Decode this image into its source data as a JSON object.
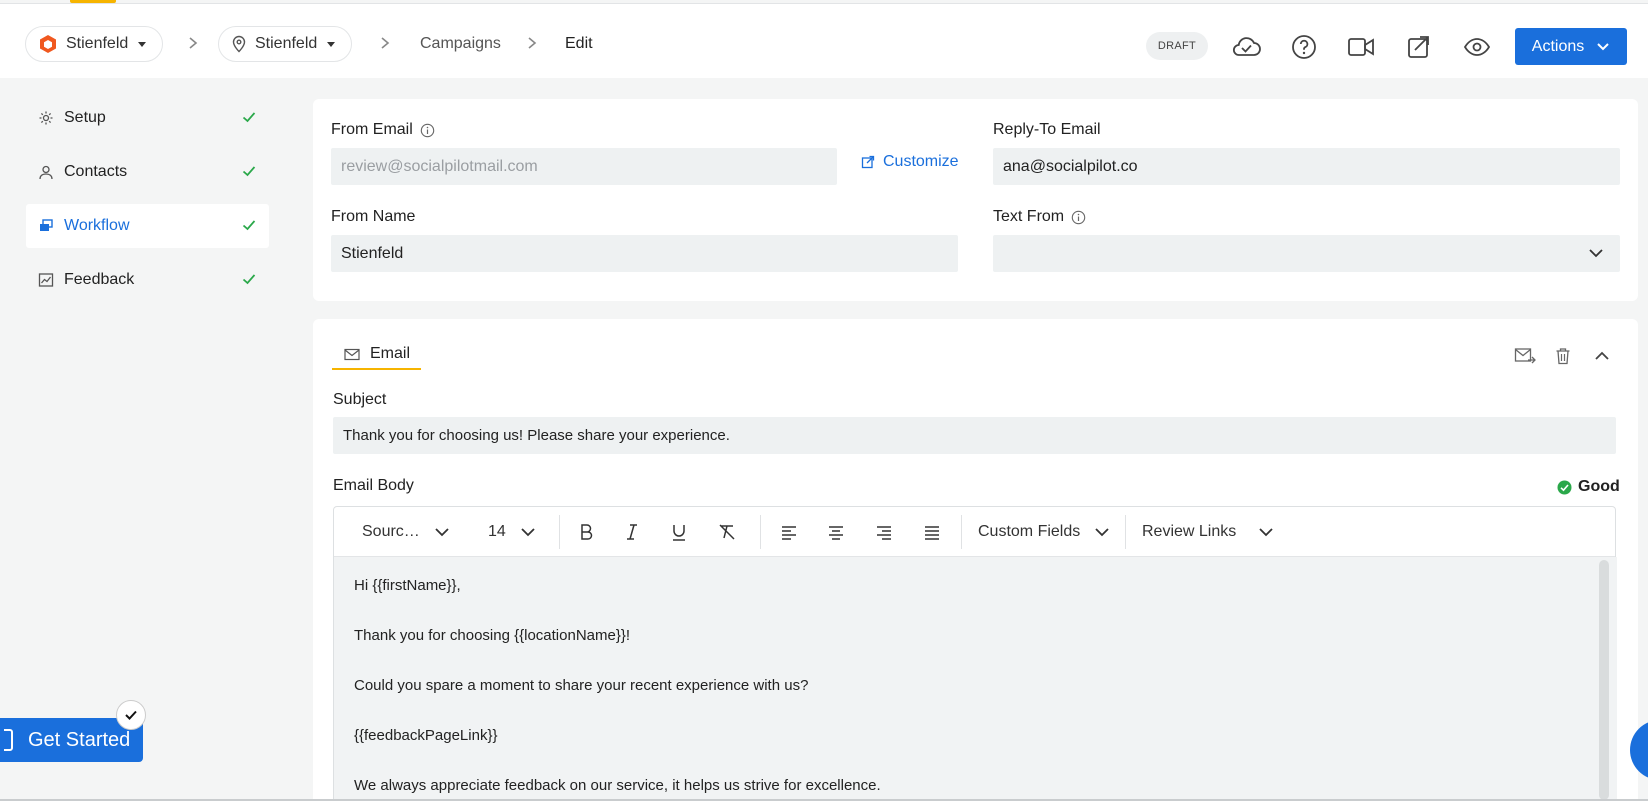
{
  "header": {
    "org_name": "Stienfeld",
    "location_name": "Stienfeld",
    "breadcrumbs": [
      "Campaigns",
      "Edit"
    ],
    "status": "DRAFT",
    "icons": [
      "cloud-check-icon",
      "help-icon",
      "video-icon",
      "send-icon",
      "eye-icon"
    ],
    "actions_label": "Actions"
  },
  "sidebar": {
    "items": [
      {
        "label": "Setup",
        "icon": "gear-icon",
        "done": true
      },
      {
        "label": "Contacts",
        "icon": "user-icon",
        "done": true
      },
      {
        "label": "Workflow",
        "icon": "workflow-icon",
        "done": true,
        "active": true
      },
      {
        "label": "Feedback",
        "icon": "chart-icon",
        "done": true
      }
    ]
  },
  "sender": {
    "from_email_label": "From Email",
    "from_email_placeholder": "review@socialpilotmail.com",
    "customize_label": "Customize",
    "reply_to_label": "Reply-To Email",
    "reply_to_value": "ana@socialpilot.co",
    "from_name_label": "From Name",
    "from_name_value": "Stienfeld",
    "text_from_label": "Text From",
    "text_from_value": ""
  },
  "email": {
    "tab_label": "Email",
    "subject_label": "Subject",
    "subject_value": "Thank you for choosing us! Please share your experience.",
    "body_label": "Email Body",
    "quality": "Good",
    "quality_color": "#2aa84a",
    "toolbar": {
      "font": "Sourc…",
      "size": "14",
      "custom_fields": "Custom Fields",
      "review_links": "Review Links"
    },
    "body_lines": [
      "Hi {{firstName}},",
      "Thank you for choosing {{locationName}}!",
      "Could you spare a moment to share your recent experience with us?",
      "{{feedbackPageLink}}",
      "We always appreciate feedback on our service, it helps us strive for excellence."
    ]
  },
  "get_started_label": "Get Started",
  "colors": {
    "accent": "#1a6fdc",
    "highlight": "#f6b400",
    "check": "#2aa84a"
  }
}
